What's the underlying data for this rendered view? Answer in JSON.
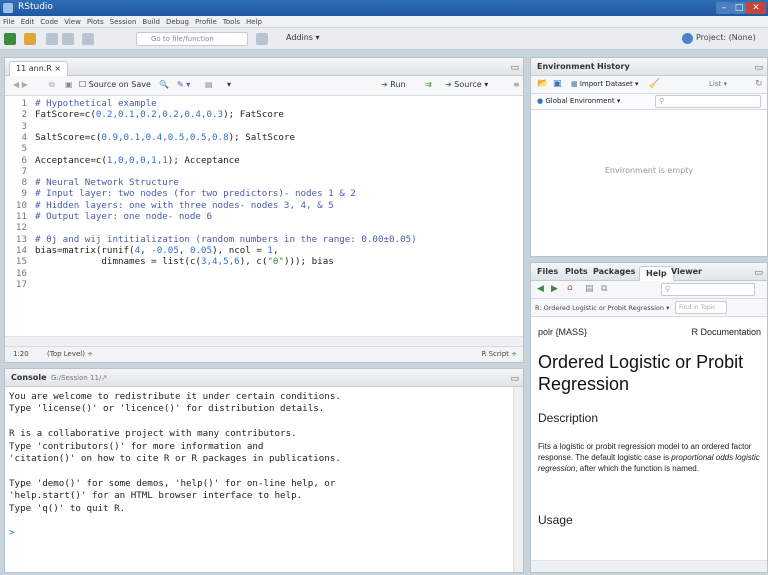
{
  "window": {
    "title": "RStudio",
    "min": "–",
    "max": "□",
    "close": "✕"
  },
  "menu": [
    "File",
    "Edit",
    "Code",
    "View",
    "Plots",
    "Session",
    "Build",
    "Debug",
    "Profile",
    "Tools",
    "Help"
  ],
  "toolbar": {
    "goto_placeholder": "Go to file/function",
    "addins": "Addins ▾",
    "project": "Project: (None)"
  },
  "source": {
    "tab": "11 ann.R ×",
    "source_on_save": "Source on Save",
    "run": "Run",
    "source_btn": "Source ▾",
    "lines": [
      {
        "n": "1",
        "parts": [
          [
            "cmt",
            "# Hypothetical example"
          ]
        ]
      },
      {
        "n": "2",
        "parts": [
          [
            "",
            "FatScore=c("
          ],
          [
            "num",
            "0.2,0.1,0.2,0.2,0.4,0.3"
          ],
          [
            "",
            "); FatScore"
          ]
        ]
      },
      {
        "n": "3",
        "parts": []
      },
      {
        "n": "4",
        "parts": [
          [
            "",
            "SaltScore=c("
          ],
          [
            "num",
            "0.9,0.1,0.4,0.5,0.5,0.8"
          ],
          [
            "",
            "); SaltScore"
          ]
        ]
      },
      {
        "n": "5",
        "parts": []
      },
      {
        "n": "6",
        "parts": [
          [
            "",
            "Acceptance=c("
          ],
          [
            "num",
            "1,0,0,0,1,1"
          ],
          [
            "",
            "); Acceptance"
          ]
        ]
      },
      {
        "n": "7",
        "parts": []
      },
      {
        "n": "8",
        "parts": [
          [
            "cmt",
            "# Neural Network Structure"
          ]
        ]
      },
      {
        "n": "9",
        "parts": [
          [
            "cmt",
            "# Input layer: two nodes (for two predictors)- nodes 1 & 2"
          ]
        ]
      },
      {
        "n": "10",
        "parts": [
          [
            "cmt",
            "# Hidden layers: one with three nodes- nodes 3, 4, & 5"
          ]
        ]
      },
      {
        "n": "11",
        "parts": [
          [
            "cmt",
            "# Output layer: one node- node 6"
          ]
        ]
      },
      {
        "n": "12",
        "parts": []
      },
      {
        "n": "13",
        "parts": [
          [
            "cmt",
            "# θj and wij intitialization (random numbers in the range: 0.00±0.05)"
          ]
        ]
      },
      {
        "n": "14",
        "parts": [
          [
            "",
            "bias=matrix(runif("
          ],
          [
            "num",
            "4"
          ],
          [
            "",
            ", "
          ],
          [
            "num",
            "-0.05"
          ],
          [
            "",
            ", "
          ],
          [
            "num",
            "0.05"
          ],
          [
            "",
            "), ncol = "
          ],
          [
            "num",
            "1"
          ],
          [
            "",
            ","
          ]
        ]
      },
      {
        "n": "15",
        "parts": [
          [
            "",
            "            dimnames = list(c("
          ],
          [
            "num",
            "3,4,5,6"
          ],
          [
            "",
            "), c("
          ],
          [
            "str",
            "\"θ\""
          ],
          [
            "",
            "))); bias"
          ]
        ]
      },
      {
        "n": "16",
        "parts": []
      },
      {
        "n": "17",
        "parts": []
      }
    ],
    "status_pos": "1:20",
    "status_scope": "(Top Level) ÷",
    "status_type": "R Script ÷"
  },
  "console": {
    "title": "Console",
    "path": "G:/Session 11/",
    "lines": [
      "You are welcome to redistribute it under certain conditions.",
      "Type 'license()' or 'licence()' for distribution details.",
      "",
      "R is a collaborative project with many contributors.",
      "Type 'contributors()' for more information and",
      "'citation()' on how to cite R or R packages in publications.",
      "",
      "Type 'demo()' for some demos, 'help()' for on-line help, or",
      "'help.start()' for an HTML browser interface to help.",
      "Type 'q()' to quit R.",
      "",
      ">"
    ]
  },
  "environment": {
    "tabs": [
      "Environment",
      "History"
    ],
    "import": "Import Dataset ▾",
    "list": "List ▾",
    "global": "Global Environment ▾",
    "empty": "Environment is empty"
  },
  "help": {
    "tabs": [
      "Files",
      "Plots",
      "Packages",
      "Help",
      "Viewer"
    ],
    "nav_topic": "R: Ordered Logistic or Probit Regression ▾",
    "find_placeholder": "Find in Topic",
    "pkg": "polr {MASS}",
    "doc": "R Documentation",
    "title": "Ordered Logistic or Probit Regression",
    "desc_heading": "Description",
    "desc1": "Fits a logistic or probit regression model to an ordered factor response. The default logistic case is ",
    "desc_em": "proportional odds logistic regression",
    "desc2": ", after which the function is named.",
    "usage_heading": "Usage"
  },
  "colors": {
    "accent": "#2e6fd1",
    "comment": "#4b5da8",
    "string": "#2a8a34",
    "titlebar": "#1f58a0"
  }
}
